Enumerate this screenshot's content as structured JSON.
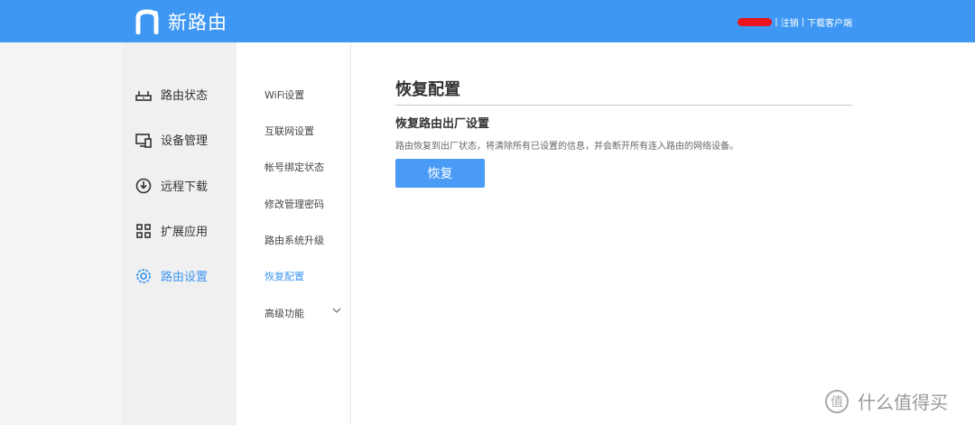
{
  "header": {
    "brand": "新路由",
    "links": {
      "logout": "注销",
      "download": "下载客户端"
    },
    "separator": "|"
  },
  "sidebar": {
    "items": [
      {
        "label": "路由状态",
        "icon": "router-icon",
        "active": false
      },
      {
        "label": "设备管理",
        "icon": "device-icon",
        "active": false
      },
      {
        "label": "远程下载",
        "icon": "download-icon",
        "active": false
      },
      {
        "label": "扩展应用",
        "icon": "apps-icon",
        "active": false
      },
      {
        "label": "路由设置",
        "icon": "settings-icon",
        "active": true
      }
    ]
  },
  "subnav": {
    "items": [
      {
        "label": "WiFi设置"
      },
      {
        "label": "互联网设置"
      },
      {
        "label": "帐号绑定状态"
      },
      {
        "label": "修改管理密码"
      },
      {
        "label": "路由系统升级"
      },
      {
        "label": "恢复配置",
        "active": true
      },
      {
        "label": "高级功能",
        "expandable": true
      }
    ]
  },
  "main": {
    "title": "恢复配置",
    "section_title": "恢复路由出厂设置",
    "description": "路由恢复到出厂状态，将清除所有已设置的信息，并会断开所有连入路由的网络设备。",
    "restore_button": "恢复"
  },
  "watermark": {
    "text": "什么值得买"
  },
  "colors": {
    "accent": "#3e97f2",
    "redaction": "#e8141e"
  }
}
